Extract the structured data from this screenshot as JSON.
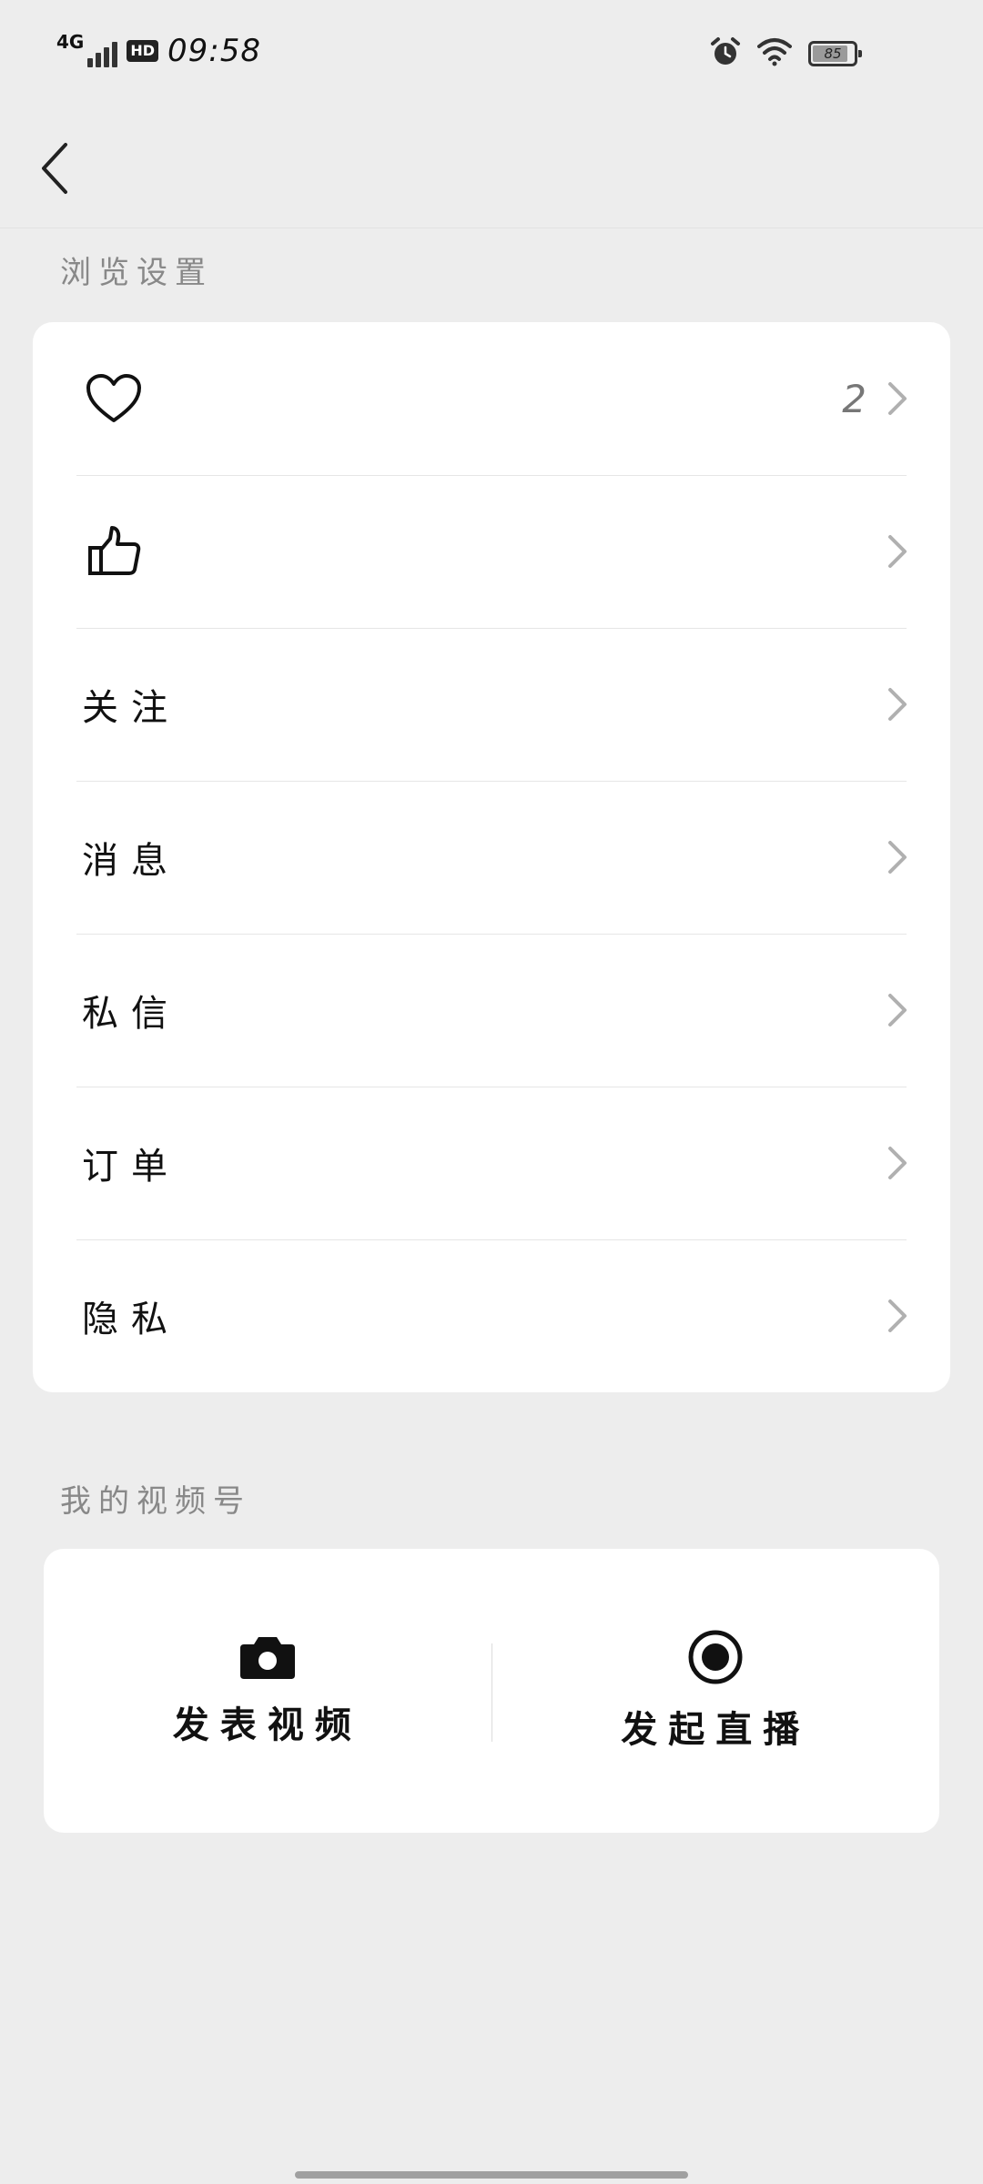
{
  "status_bar": {
    "network": "4G",
    "hd": "HD",
    "time": "09:58",
    "battery": "85"
  },
  "sections": {
    "browse_settings": "浏览设置",
    "my_channel": "我的视频号"
  },
  "rows": [
    {
      "icon": "heart-icon",
      "label": "",
      "count": "2"
    },
    {
      "icon": "thumbs-up-icon",
      "label": "",
      "count": ""
    },
    {
      "icon": "",
      "label": "关注",
      "count": ""
    },
    {
      "icon": "",
      "label": "消息",
      "count": ""
    },
    {
      "icon": "",
      "label": "私信",
      "count": ""
    },
    {
      "icon": "",
      "label": "订单",
      "count": ""
    },
    {
      "icon": "",
      "label": "隐私",
      "count": ""
    }
  ],
  "video_actions": {
    "publish_label": "发表视频",
    "publish_icon": "camera-icon",
    "live_label": "发起直播",
    "live_icon": "live-record-icon"
  },
  "colors": {
    "background": "#ededed",
    "card": "#ffffff",
    "section_text": "#888888",
    "chevron": "#b0b0b0"
  }
}
